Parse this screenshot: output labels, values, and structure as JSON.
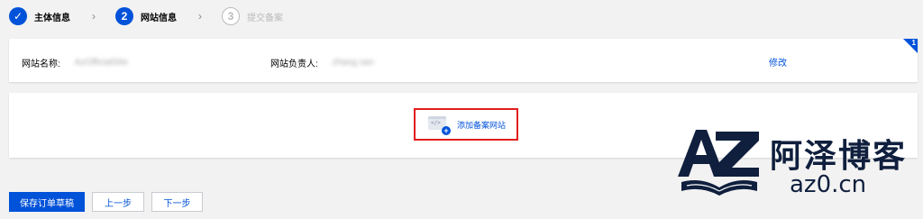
{
  "stepper": {
    "steps": [
      {
        "number": "✓",
        "label": "主体信息",
        "state": "done"
      },
      {
        "number": "2",
        "label": "网站信息",
        "state": "active"
      },
      {
        "number": "3",
        "label": "提交备案",
        "state": "pending"
      }
    ],
    "separator": "›"
  },
  "site_info": {
    "name_label": "网站名称:",
    "name_value": "AzOfficialSite",
    "owner_label": "网站负责人:",
    "owner_value": "zhang san",
    "modify_link": "修改",
    "badge_count": "1"
  },
  "add_site": {
    "label": "添加备案网站",
    "icon": "code-window-add-icon",
    "code_glyph": "</>",
    "plus_glyph": "+"
  },
  "actions": {
    "save_draft": "保存订单草稿",
    "prev": "上一步",
    "next": "下一步"
  },
  "watermark": {
    "title": "阿泽博客",
    "domain": "az0.cn"
  },
  "colors": {
    "primary": "#0052d9",
    "highlight_border": "#e21d1d",
    "watermark": "#0f1f3d"
  }
}
